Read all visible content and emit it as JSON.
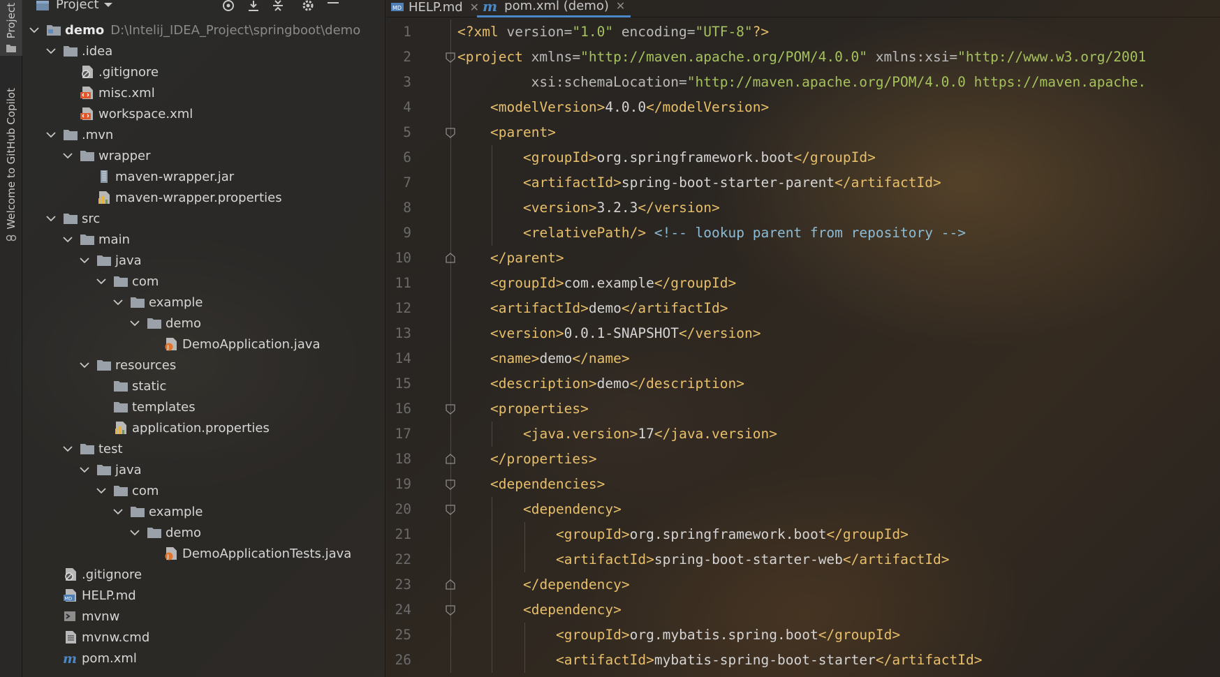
{
  "toolstrip": {
    "project_label": "Project",
    "copilot_label": "Welcome to GitHub Copilot"
  },
  "project_panel": {
    "title": "Project",
    "header_icons": [
      "locate-icon",
      "expand-all-icon",
      "collapse-all-icon",
      "gear-icon",
      "minimize-icon"
    ],
    "tree": [
      {
        "level": 0,
        "type": "module",
        "expanded": true,
        "name": "demo",
        "path": "D:\\Intelij_IDEA_Project\\springboot\\demo"
      },
      {
        "level": 1,
        "type": "folder",
        "expanded": true,
        "name": ".idea"
      },
      {
        "level": 2,
        "type": "gitignore",
        "name": ".gitignore"
      },
      {
        "level": 2,
        "type": "xml",
        "name": "misc.xml"
      },
      {
        "level": 2,
        "type": "xml",
        "name": "workspace.xml"
      },
      {
        "level": 1,
        "type": "folder",
        "expanded": true,
        "name": ".mvn"
      },
      {
        "level": 2,
        "type": "folder",
        "expanded": true,
        "name": "wrapper"
      },
      {
        "level": 3,
        "type": "jar",
        "name": "maven-wrapper.jar"
      },
      {
        "level": 3,
        "type": "properties",
        "name": "maven-wrapper.properties"
      },
      {
        "level": 1,
        "type": "folder",
        "expanded": true,
        "name": "src"
      },
      {
        "level": 2,
        "type": "folder",
        "expanded": true,
        "name": "main"
      },
      {
        "level": 3,
        "type": "folder",
        "expanded": true,
        "name": "java"
      },
      {
        "level": 4,
        "type": "folder",
        "expanded": true,
        "name": "com"
      },
      {
        "level": 5,
        "type": "folder",
        "expanded": true,
        "name": "example"
      },
      {
        "level": 6,
        "type": "folder",
        "expanded": true,
        "name": "demo"
      },
      {
        "level": 7,
        "type": "java",
        "name": "DemoApplication.java"
      },
      {
        "level": 3,
        "type": "folder",
        "expanded": true,
        "name": "resources"
      },
      {
        "level": 4,
        "type": "folder",
        "name": "static"
      },
      {
        "level": 4,
        "type": "folder",
        "name": "templates"
      },
      {
        "level": 4,
        "type": "properties",
        "name": "application.properties"
      },
      {
        "level": 2,
        "type": "folder",
        "expanded": true,
        "name": "test"
      },
      {
        "level": 3,
        "type": "folder",
        "expanded": true,
        "name": "java"
      },
      {
        "level": 4,
        "type": "folder",
        "expanded": true,
        "name": "com"
      },
      {
        "level": 5,
        "type": "folder",
        "expanded": true,
        "name": "example"
      },
      {
        "level": 6,
        "type": "folder",
        "expanded": true,
        "name": "demo"
      },
      {
        "level": 7,
        "type": "java",
        "name": "DemoApplicationTests.java"
      },
      {
        "level": 1,
        "type": "gitignore",
        "name": ".gitignore"
      },
      {
        "level": 1,
        "type": "md",
        "name": "HELP.md"
      },
      {
        "level": 1,
        "type": "shell",
        "name": "mvnw"
      },
      {
        "level": 1,
        "type": "cmd",
        "name": "mvnw.cmd"
      },
      {
        "level": 1,
        "type": "maven",
        "name": "pom.xml"
      }
    ]
  },
  "editor": {
    "tabs": [
      {
        "label": "HELP.md",
        "icon": "markdown-icon",
        "active": false
      },
      {
        "label": "pom.xml (demo)",
        "icon": "maven-icon",
        "active": true
      }
    ],
    "lines": [
      {
        "n": "1",
        "indent": 0,
        "fold": "",
        "segs": [
          [
            "tag",
            "<?xml "
          ],
          [
            "attr",
            "version="
          ],
          [
            "str2",
            "\"1.0\""
          ],
          [
            "attr",
            " encoding="
          ],
          [
            "str2",
            "\"UTF-8\""
          ],
          [
            "tag",
            "?>"
          ]
        ]
      },
      {
        "n": "2",
        "indent": 0,
        "fold": "open",
        "segs": [
          [
            "tag",
            "<project "
          ],
          [
            "attr",
            "xmlns="
          ],
          [
            "str2",
            "\"http://maven.apache.org/POM/4.0.0\""
          ],
          [
            "attr",
            " xmlns:xsi="
          ],
          [
            "str2",
            "\"http://www.w3.org/2001"
          ]
        ]
      },
      {
        "n": "3",
        "indent": 0,
        "fold": "",
        "segs": [
          [
            "attr",
            "         xsi:schemaLocation="
          ],
          [
            "str2",
            "\"http://maven.apache.org/POM/4.0.0 https://maven.apache."
          ]
        ]
      },
      {
        "n": "4",
        "indent": 1,
        "fold": "",
        "segs": [
          [
            "tag",
            "<modelVersion>"
          ],
          [
            "txt",
            "4.0.0"
          ],
          [
            "tag",
            "</modelVersion>"
          ]
        ]
      },
      {
        "n": "5",
        "indent": 1,
        "fold": "open",
        "segs": [
          [
            "tag",
            "<parent>"
          ]
        ]
      },
      {
        "n": "6",
        "indent": 2,
        "fold": "",
        "segs": [
          [
            "tag",
            "<groupId>"
          ],
          [
            "txt",
            "org.springframework.boot"
          ],
          [
            "tag",
            "</groupId>"
          ]
        ]
      },
      {
        "n": "7",
        "indent": 2,
        "fold": "",
        "segs": [
          [
            "tag",
            "<artifactId>"
          ],
          [
            "txt",
            "spring-boot-starter-parent"
          ],
          [
            "tag",
            "</artifactId>"
          ]
        ]
      },
      {
        "n": "8",
        "indent": 2,
        "fold": "",
        "segs": [
          [
            "tag",
            "<version>"
          ],
          [
            "txt",
            "3.2.3"
          ],
          [
            "tag",
            "</version>"
          ]
        ]
      },
      {
        "n": "9",
        "indent": 2,
        "fold": "",
        "segs": [
          [
            "tag",
            "<relativePath/>"
          ],
          [
            "cmt",
            " <!-- lookup parent from repository -->"
          ]
        ]
      },
      {
        "n": "10",
        "indent": 1,
        "fold": "close",
        "segs": [
          [
            "tag",
            "</parent>"
          ]
        ]
      },
      {
        "n": "11",
        "indent": 1,
        "fold": "",
        "segs": [
          [
            "tag",
            "<groupId>"
          ],
          [
            "txt",
            "com.example"
          ],
          [
            "tag",
            "</groupId>"
          ]
        ]
      },
      {
        "n": "12",
        "indent": 1,
        "fold": "",
        "segs": [
          [
            "tag",
            "<artifactId>"
          ],
          [
            "txt",
            "demo"
          ],
          [
            "tag",
            "</artifactId>"
          ]
        ]
      },
      {
        "n": "13",
        "indent": 1,
        "fold": "",
        "segs": [
          [
            "tag",
            "<version>"
          ],
          [
            "txt",
            "0.0.1-SNAPSHOT"
          ],
          [
            "tag",
            "</version>"
          ]
        ]
      },
      {
        "n": "14",
        "indent": 1,
        "fold": "",
        "segs": [
          [
            "tag",
            "<name>"
          ],
          [
            "txt",
            "demo"
          ],
          [
            "tag",
            "</name>"
          ]
        ]
      },
      {
        "n": "15",
        "indent": 1,
        "fold": "",
        "segs": [
          [
            "tag",
            "<description>"
          ],
          [
            "txt",
            "demo"
          ],
          [
            "tag",
            "</description>"
          ]
        ]
      },
      {
        "n": "16",
        "indent": 1,
        "fold": "open",
        "segs": [
          [
            "tag",
            "<properties>"
          ]
        ]
      },
      {
        "n": "17",
        "indent": 2,
        "fold": "",
        "segs": [
          [
            "tag",
            "<java.version>"
          ],
          [
            "txt",
            "17"
          ],
          [
            "tag",
            "</java.version>"
          ]
        ]
      },
      {
        "n": "18",
        "indent": 1,
        "fold": "close",
        "segs": [
          [
            "tag",
            "</properties>"
          ]
        ]
      },
      {
        "n": "19",
        "indent": 1,
        "fold": "open",
        "segs": [
          [
            "tag",
            "<dependencies>"
          ]
        ]
      },
      {
        "n": "20",
        "indent": 2,
        "fold": "open",
        "segs": [
          [
            "tag",
            "<dependency>"
          ]
        ]
      },
      {
        "n": "21",
        "indent": 3,
        "fold": "",
        "segs": [
          [
            "tag",
            "<groupId>"
          ],
          [
            "txt",
            "org.springframework.boot"
          ],
          [
            "tag",
            "</groupId>"
          ]
        ]
      },
      {
        "n": "22",
        "indent": 3,
        "fold": "",
        "segs": [
          [
            "tag",
            "<artifactId>"
          ],
          [
            "txt",
            "spring-boot-starter-web"
          ],
          [
            "tag",
            "</artifactId>"
          ]
        ]
      },
      {
        "n": "23",
        "indent": 2,
        "fold": "close",
        "segs": [
          [
            "tag",
            "</dependency>"
          ]
        ]
      },
      {
        "n": "24",
        "indent": 2,
        "fold": "open",
        "segs": [
          [
            "tag",
            "<dependency>"
          ]
        ]
      },
      {
        "n": "25",
        "indent": 3,
        "fold": "",
        "segs": [
          [
            "tag",
            "<groupId>"
          ],
          [
            "txt",
            "org.mybatis.spring.boot"
          ],
          [
            "tag",
            "</groupId>"
          ]
        ]
      },
      {
        "n": "26",
        "indent": 3,
        "fold": "",
        "segs": [
          [
            "tag",
            "<artifactId>"
          ],
          [
            "txt",
            "mybatis-spring-boot-starter"
          ],
          [
            "tag",
            "</artifactId>"
          ]
        ]
      }
    ]
  }
}
